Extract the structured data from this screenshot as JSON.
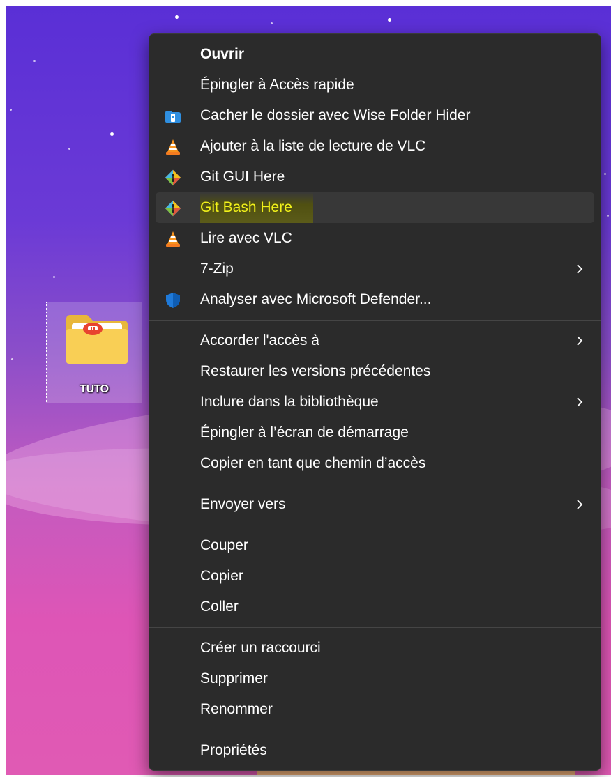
{
  "desktop": {
    "folder": {
      "name": "TUTO",
      "icon": "folder-icon"
    }
  },
  "context_menu": {
    "groups": [
      [
        {
          "label": "Ouvrir",
          "bold": true
        },
        {
          "label": "Épingler à Accès rapide"
        },
        {
          "label": "Cacher le dossier avec Wise Folder Hider",
          "icon": "wise-folder-hider-icon"
        },
        {
          "label": "Ajouter à la liste de lecture de VLC",
          "icon": "vlc-icon"
        },
        {
          "label": "Git GUI Here",
          "icon": "git-icon"
        },
        {
          "label": "Git Bash Here",
          "icon": "git-icon",
          "hovered": true,
          "highlighted": true
        },
        {
          "label": "Lire avec VLC",
          "icon": "vlc-icon"
        },
        {
          "label": "7-Zip",
          "submenu": true
        },
        {
          "label": "Analyser avec Microsoft Defender...",
          "icon": "defender-shield-icon"
        }
      ],
      [
        {
          "label": "Accorder l'accès à",
          "submenu": true
        },
        {
          "label": "Restaurer les versions précédentes"
        },
        {
          "label": "Inclure dans la bibliothèque",
          "submenu": true
        },
        {
          "label": "Épingler à l’écran de démarrage"
        },
        {
          "label": "Copier en tant que chemin d’accès"
        }
      ],
      [
        {
          "label": "Envoyer vers",
          "submenu": true
        }
      ],
      [
        {
          "label": "Couper"
        },
        {
          "label": "Copier"
        },
        {
          "label": "Coller"
        }
      ],
      [
        {
          "label": "Créer un raccourci"
        },
        {
          "label": "Supprimer"
        },
        {
          "label": "Renommer"
        }
      ],
      [
        {
          "label": "Propriétés"
        }
      ]
    ]
  },
  "colors": {
    "menu_background": "#2b2b2b",
    "menu_hover": "#383838",
    "menu_text": "#ffffff",
    "highlight_text": "#f2f21a",
    "separator": "#454545"
  }
}
